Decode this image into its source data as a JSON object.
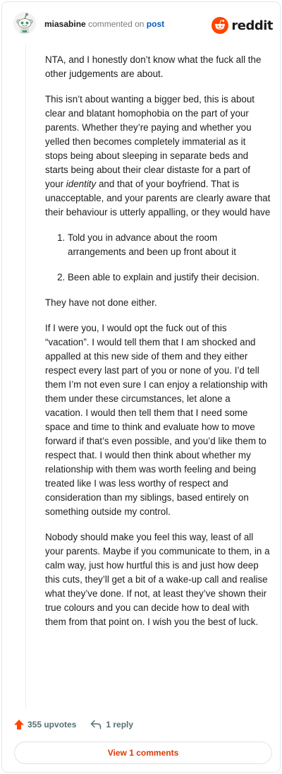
{
  "header": {
    "username": "miasabine",
    "action_text": "commented on",
    "post_link": "post",
    "brand": "reddit",
    "colors": {
      "brand": "#ff4500",
      "link": "#0a5bbd"
    }
  },
  "comment": {
    "p1": "NTA, and I honestly don’t know what the fuck all the other judgements are about.",
    "p2_a": "This isn’t about wanting a bigger bed, this is about clear and blatant homophobia on the part of your parents. Whether they’re paying and whether you yelled then becomes completely immaterial as it stops being about sleeping in separate beds and starts being about their clear distaste for a part of your ",
    "p2_em": "identity",
    "p2_b": " and that of your boyfriend. That is unacceptable, and your parents are clearly aware that their behaviour is utterly appalling, or they would have",
    "list": [
      "Told you in advance about the room arrangements and been up front about it",
      "Been able to explain and justify their decision."
    ],
    "p3": "They have not done either.",
    "p4": "If I were you, I would opt the fuck out of this “vacation”. I would tell them that I am shocked and appalled at this new side of them and they either respect every last part of you or none of you. I’d tell them I’m not even sure I can enjoy a relationship with them under these circumstances, let alone a vacation. I would then tell them that I need some space and time to think and evaluate how to move forward if that’s even possible, and you’d like them to respect that. I would then think about whether my relationship with them was worth feeling and being treated like I was less worthy of respect and consideration than my siblings, based entirely on something outside my control.",
    "p5": "Nobody should make you feel this way, least of all your parents. Maybe if you communicate to them, in a calm way, just how hurtful this is and just how deep this cuts, they’ll get a bit of a wake-up call and realise what they’ve done. If not, at least they’ve shown their true colours and you can decide how to deal with them from that point on. I wish you the best of luck."
  },
  "footer": {
    "upvotes": "355 upvotes",
    "replies": "1 reply",
    "view_comments": "View 1 comments",
    "colors": {
      "upvote": "#ff4500",
      "muted": "#576f76",
      "view": "#d93a00"
    }
  }
}
